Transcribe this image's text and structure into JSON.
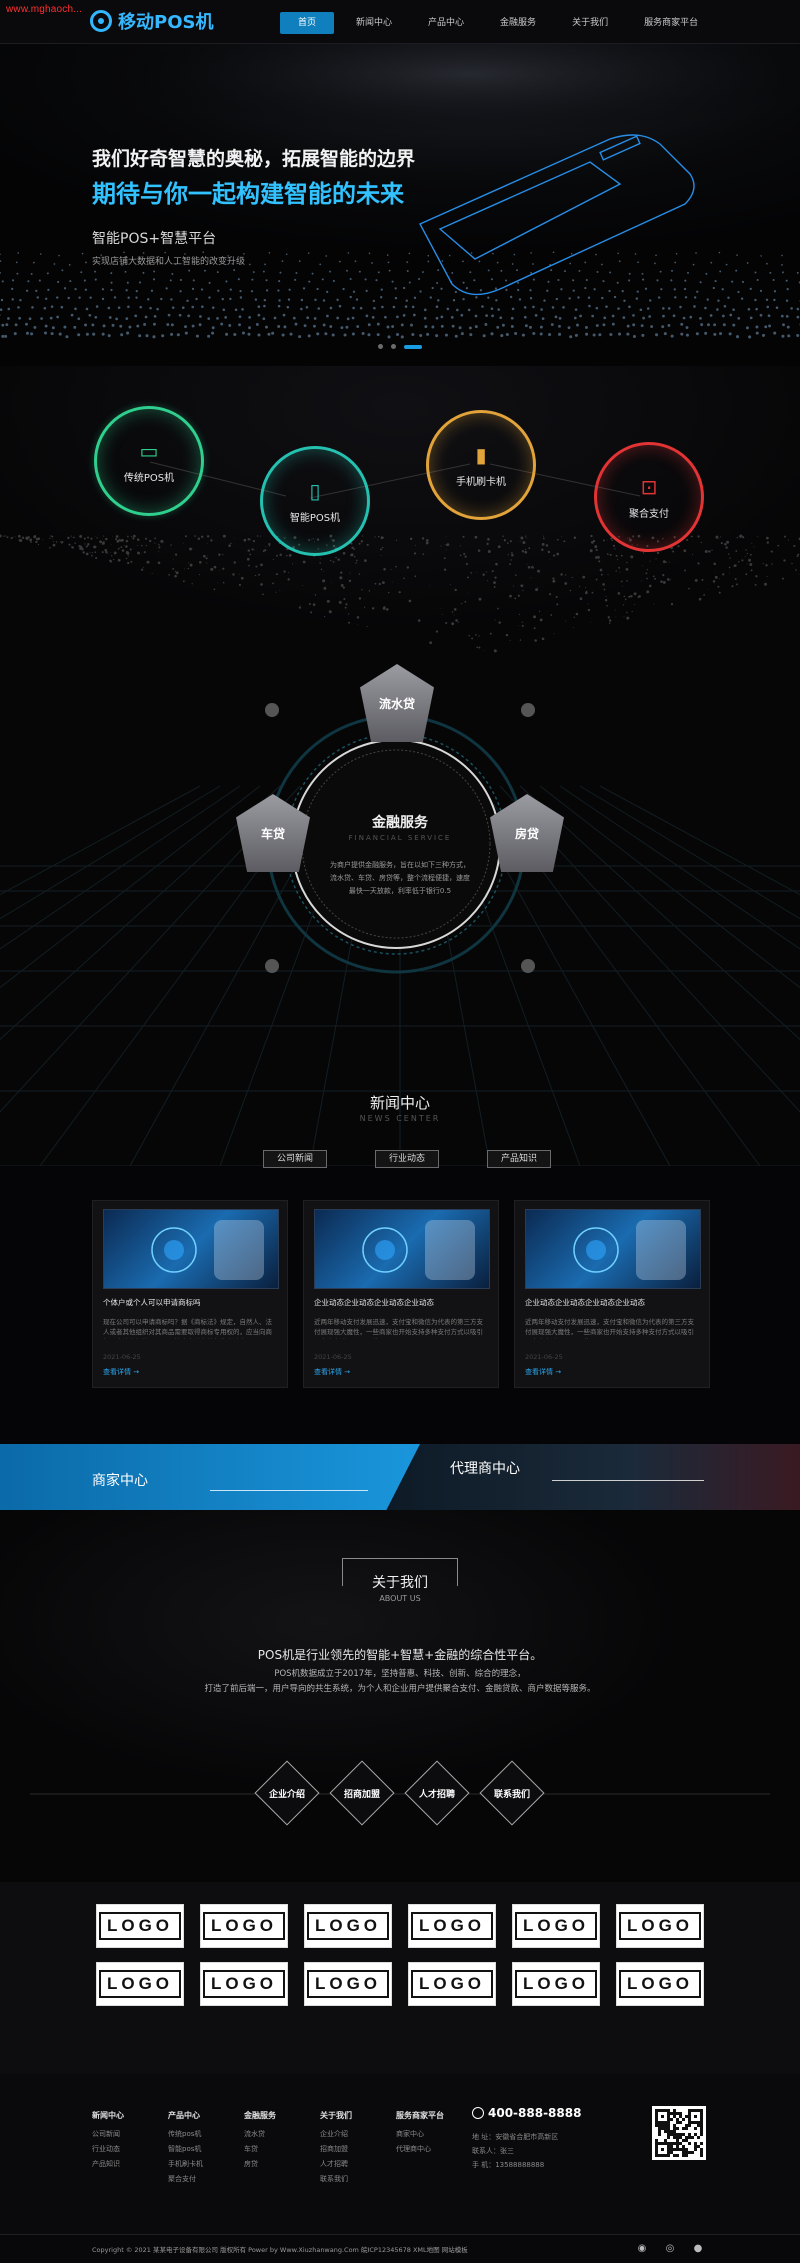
{
  "header": {
    "site_url": "www.mghaoch...",
    "logo_text": "移动POS机",
    "nav": [
      "首页",
      "新闻中心",
      "产品中心",
      "金融服务",
      "关于我们",
      "服务商家平台"
    ],
    "active_index": 0
  },
  "hero": {
    "line1": "我们好奇智慧的奥秘，拓展智能的边界",
    "line2": "期待与你一起构建智能的未来",
    "line3": "智能POS+智慧平台",
    "line4": "实现店铺大数据和人工智能的改变升级",
    "slide_count": 3,
    "active_slide": 2
  },
  "features": {
    "items": [
      {
        "label": "传统POS机",
        "color": "#2fcf8e",
        "icon": "card-icon"
      },
      {
        "label": "智能POS机",
        "color": "#25c1b0",
        "icon": "pos-terminal-icon"
      },
      {
        "label": "手机刷卡机",
        "color": "#e1a33a",
        "icon": "phone-icon"
      },
      {
        "label": "聚合支付",
        "color": "#e23434",
        "icon": "qr-scan-icon"
      }
    ]
  },
  "finance": {
    "title": "金融服务",
    "subtitle": "FINANCIAL SERVICE",
    "desc_line1": "为商户提供金融服务，旨在以如下三种方式，",
    "desc_line2": "流水贷、车贷、房贷等，整个流程便捷，速度",
    "desc_line3": "最快一天放款，利率低于银行0.5",
    "hex": [
      "流水贷",
      "车贷",
      "房贷"
    ]
  },
  "news": {
    "title": "新闻中心",
    "subtitle": "NEWS CENTER",
    "tabs": [
      "公司新闻",
      "行业动态",
      "产品知识"
    ],
    "cards": [
      {
        "title": "个体户或个人可以申请商标吗",
        "desc": "现在公司可以申请商标吗？据《商标法》规定，自然人、法人或者其他组织对其商品需要取得商标专用权的，应当向商标局申请商标注册，只要符合申请条件都能申请商…",
        "date": "2021-06-25",
        "more": "查看详情 →"
      },
      {
        "title": "企业动态企业动态企业动态企业动态",
        "desc": "近两年移动支付发展迅速，支付宝和微信为代表的第三方支付展现强大魔性，一些商家也开始支持多种支付方式以吸引更多客户进入，而一些…",
        "date": "2021-06-25",
        "more": "查看详情 →"
      },
      {
        "title": "企业动态企业动态企业动态企业动态",
        "desc": "近两年移动支付发展迅速，支付宝和微信为代表的第三方支付展现强大魔性，一些商家也开始支持多种支付方式以吸引更多客户进入，而一些…",
        "date": "2021-06-25",
        "more": "查看详情 →"
      }
    ]
  },
  "band": {
    "left": "商家中心",
    "right": "代理商中心"
  },
  "about": {
    "title": "关于我们",
    "subtitle": "ABOUT US",
    "p1": "POS机是行业领先的智能+智慧+金融的综合性平台。",
    "p2": "POS机数据成立于2017年，坚持普惠、科技、创新、综合的理念，",
    "p3": "打造了前后端一，用户导向的共生系统，为个人和企业用户提供聚合支付、金融贷款、商户数据等服务。",
    "buttons": [
      "企业介绍",
      "招商加盟",
      "人才招聘",
      "联系我们"
    ]
  },
  "logos": {
    "text": "LOGO",
    "count": 12
  },
  "footer": {
    "columns": [
      {
        "head": "新闻中心",
        "links": [
          "公司新闻",
          "行业动态",
          "产品知识"
        ]
      },
      {
        "head": "产品中心",
        "links": [
          "传统pos机",
          "智能pos机",
          "手机刷卡机",
          "聚合支付"
        ]
      },
      {
        "head": "金融服务",
        "links": [
          "流水贷",
          "车贷",
          "房贷"
        ]
      },
      {
        "head": "关于我们",
        "links": [
          "企业介绍",
          "招商加盟",
          "人才招聘",
          "联系我们"
        ]
      },
      {
        "head": "服务商家平台",
        "links": [
          "商家中心",
          "代理商中心"
        ]
      }
    ],
    "phone": "400-888-8888",
    "address": "地 址：安徽省合肥市高新区",
    "contact": "联系人：张三",
    "mobile": "手 机：13588888888",
    "copyright": "Copyright © 2021 某某电子设备有限公司 版权所有 Power by Www.Xiuzhanwang.Com 皖ICP12345678 XML地图 网站模板"
  }
}
